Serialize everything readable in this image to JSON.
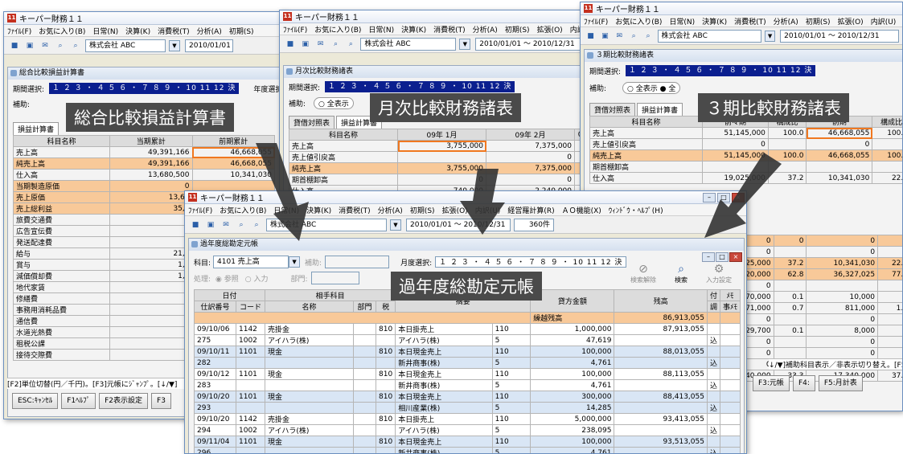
{
  "app_title": "キーパー財務１１",
  "app_icon_text": "11",
  "menu": [
    "ﾌｧｲﾙ(F)",
    "お気に入り(B)",
    "日常(N)",
    "決算(K)",
    "消費税(T)",
    "分析(A)",
    "初期(S)",
    "拡張(O)",
    "内訳(U)",
    "経営"
  ],
  "menu_front": [
    "ﾌｧｲﾙ(F)",
    "お気に入り(B)",
    "日常(N)",
    "決算(K)",
    "消費税(T)",
    "分析(A)",
    "初期(S)",
    "拡張(O)",
    "内訳(U)",
    "経営羅計算(R)",
    "ＡＯ機能(X)",
    "ｳｨﾝﾄﾞｳ・ﾍﾙﾌﾟ(H)"
  ],
  "company": "株式会社 ABC",
  "date_range": "2010/01/01 〜 2010/12/31",
  "record_count": "360件",
  "period_bar": "１ ２ ３ ・ ４ ５ ６ ・ ７ ８ ９ ・ 10 11 12 決",
  "captions": {
    "comprehensive": "総合比較損益計算書",
    "monthly": "月次比較財務諸表",
    "three_period": "３期比較財務諸表",
    "general_ledger": "過年度総勘定元帳"
  },
  "comprehensive": {
    "title": "総合比較損益計算書",
    "period_label": "期間選択:",
    "year_label": "年度選択:",
    "aux_label": "補助:",
    "tab": "損益計算書",
    "headers": [
      "科目名称",
      "当期累計",
      "前期累計"
    ],
    "rows": [
      {
        "name": "売上高",
        "cur": "49,391,166",
        "prev": "46,668,055",
        "orange": false
      },
      {
        "name": "純売上高",
        "cur": "49,391,166",
        "prev": "46,668,055",
        "orange": true
      },
      {
        "name": "仕入高",
        "cur": "13,680,500",
        "prev": "10,341,030",
        "orange": false
      },
      {
        "name": "当期製造原価",
        "cur": "0",
        "prev": "",
        "orange": true
      },
      {
        "name": "売上原価",
        "cur": "13,68",
        "prev": "",
        "orange": true
      },
      {
        "name": "売上総利益",
        "cur": "35,7",
        "prev": "",
        "orange": true
      },
      {
        "name": "旅費交通費",
        "cur": "",
        "prev": "",
        "orange": false
      },
      {
        "name": "広告宣伝費",
        "cur": "7",
        "prev": "",
        "orange": false
      },
      {
        "name": "発送配達費",
        "cur": "",
        "prev": "",
        "orange": false
      },
      {
        "name": "給与",
        "cur": "21,4",
        "prev": "",
        "orange": false
      },
      {
        "name": "賞与",
        "cur": "1,8",
        "prev": "",
        "orange": false
      },
      {
        "name": "減価償却費",
        "cur": "1,8",
        "prev": "",
        "orange": false
      },
      {
        "name": "地代家賃",
        "cur": "7",
        "prev": "",
        "orange": false
      },
      {
        "name": "修繕費",
        "cur": "3",
        "prev": "",
        "orange": false
      },
      {
        "name": "事務用消耗品費",
        "cur": "",
        "prev": "",
        "orange": false
      },
      {
        "name": "通信費",
        "cur": "3",
        "prev": "",
        "orange": false
      },
      {
        "name": "水道光熱費",
        "cur": "3",
        "prev": "",
        "orange": false
      },
      {
        "name": "租税公課",
        "cur": "",
        "prev": "",
        "orange": false
      },
      {
        "name": "接待交際費",
        "cur": "",
        "prev": "",
        "orange": false
      }
    ],
    "status": "[F2]単位切替(円／千円)。[F3]元帳にｼﾞｬﾝﾌﾟ。[↓/▼]",
    "fkeys": [
      "ESC:ｷｬﾝｾﾙ",
      "F1ﾍﾙﾌﾟ",
      "F2表示設定",
      "F3"
    ]
  },
  "monthly": {
    "title": "月次比較財務諸表",
    "period_label": "期間選択:",
    "aux_label": "補助:",
    "aux_option": "全表示",
    "tabs": [
      "貸借対照表",
      "損益計算書"
    ],
    "term_label": "期間",
    "headers": [
      "科目名称",
      "09年 1月",
      "09年 2月",
      "09"
    ],
    "rows": [
      {
        "name": "売上高",
        "m1": "3,755,000",
        "m2": "7,375,000",
        "orange": false
      },
      {
        "name": "売上値引戻高",
        "m1": "",
        "m2": "0",
        "orange": false
      },
      {
        "name": "純売上高",
        "m1": "3,755,000",
        "m2": "7,375,000",
        "orange": true
      },
      {
        "name": "期首棚卸高",
        "m1": "0",
        "m2": "0",
        "orange": false
      },
      {
        "name": "仕入高",
        "m1": "740,000",
        "m2": "2,240,000",
        "orange": false
      }
    ]
  },
  "three_period": {
    "title": "３期比較財務諸表",
    "period_label": "期間選択:",
    "aux_label": "補助:",
    "aux_options": [
      "全表示",
      "全"
    ],
    "tabs": [
      "貸借対照表",
      "損益計算書"
    ],
    "headers": [
      "科目名称",
      "前々期",
      "構成比",
      "前期",
      "構成比"
    ],
    "rows": [
      {
        "name": "売上高",
        "a": "51,145,000",
        "ar": "100.0",
        "b": "46,668,055",
        "br": "100.0",
        "orange": false
      },
      {
        "name": "売上値引戻高",
        "a": "0",
        "ar": "",
        "b": "0",
        "br": "",
        "orange": false
      },
      {
        "name": "純売上高",
        "a": "51,145,000",
        "ar": "100.0",
        "b": "46,668,055",
        "br": "100.0",
        "orange": true
      },
      {
        "name": "期首棚卸高",
        "a": "",
        "ar": "",
        "b": "",
        "br": "",
        "orange": false
      },
      {
        "name": "仕入高",
        "a": "19,025,000",
        "ar": "37.2",
        "b": "10,341,030",
        "br": "22.2",
        "orange": false
      }
    ],
    "lower_rows": [
      {
        "a": "0",
        "b": "0",
        "c": "0",
        "orange": true
      },
      {
        "a": "0",
        "b": "",
        "c": "0",
        "orange": false
      },
      {
        "a": "19,025,000",
        "b": "37.2",
        "c": "10,341,030",
        "d": "22.2",
        "orange": true
      },
      {
        "a": "32,120,000",
        "b": "62.8",
        "c": "36,327,025",
        "d": "77.8",
        "orange": true
      },
      {
        "a": "0",
        "b": "",
        "c": "",
        "orange": false
      },
      {
        "a": "70,000",
        "b": "0.1",
        "c": "10,000",
        "orange": false
      },
      {
        "a": "371,000",
        "b": "0.7",
        "c": "811,000",
        "d": "1.7",
        "orange": false
      },
      {
        "a": "0",
        "b": "",
        "c": "0",
        "orange": false
      },
      {
        "a": "29,700",
        "b": "0.1",
        "c": "8,000",
        "orange": false
      },
      {
        "a": "0",
        "b": "",
        "c": "0",
        "orange": false
      },
      {
        "a": "0",
        "b": "",
        "c": "0",
        "orange": false
      },
      {
        "a": "0",
        "b": "",
        "c": "0",
        "orange": false
      },
      {
        "a": "17,040,000",
        "b": "33.3",
        "c": "17,340,000",
        "d": "37.2",
        "orange": false
      }
    ],
    "status": "↓/▼]補助科目表示／非表示切り替え。[F5]科目",
    "fkeys": [
      "F3:元帳",
      "F4:",
      "F5:月計表"
    ]
  },
  "ledger": {
    "title": "過年度総勘定元帳",
    "account_label": "科目:",
    "account_value": "4101 売上高",
    "aux_label": "補助:",
    "month_label": "月度選択:",
    "process_label": "処理:",
    "process_options": [
      "参照",
      "入力"
    ],
    "dept_label": "部門:",
    "tools": [
      "検索解除",
      "検索",
      "入力設定"
    ],
    "headers_top": [
      "日付",
      "相手科目",
      "摘要",
      "貸方金額",
      "残高",
      "付",
      "ﾒﾓ"
    ],
    "headers_bottom": [
      "仕訳番号",
      "コード",
      "名称",
      "部門",
      "税",
      "取引先",
      "調",
      "事ﾒﾓ"
    ],
    "carry_label": "繰越残高",
    "carry_balance": "86,913,055",
    "rows": [
      {
        "date": "09/10/06",
        "code": "1142",
        "name": "売掛金",
        "dept": "810",
        "desc": "本日掛売上",
        "tax": "110",
        "flag": "",
        "amount": "1,000,000",
        "balance": "87,913,055",
        "alt": false
      },
      {
        "date": "275",
        "code": "1002",
        "name": "アイハラ(株)",
        "dept": "",
        "desc": "アイハラ(株)",
        "tax": "5",
        "flag": "込",
        "amount": "47,619",
        "balance": "",
        "alt": false
      },
      {
        "date": "09/10/11",
        "code": "1101",
        "name": "現金",
        "dept": "810",
        "desc": "本日現金売上",
        "tax": "110",
        "flag": "",
        "amount": "100,000",
        "balance": "88,013,055",
        "alt": true
      },
      {
        "date": "282",
        "code": "",
        "name": "",
        "dept": "",
        "desc": "新井商事(株)",
        "tax": "5",
        "flag": "込",
        "amount": "4,761",
        "balance": "",
        "alt": true
      },
      {
        "date": "09/10/12",
        "code": "1101",
        "name": "現金",
        "dept": "810",
        "desc": "本日現金売上",
        "tax": "110",
        "flag": "",
        "amount": "100,000",
        "balance": "88,113,055",
        "alt": false
      },
      {
        "date": "283",
        "code": "",
        "name": "",
        "dept": "",
        "desc": "新井商事(株)",
        "tax": "5",
        "flag": "込",
        "amount": "4,761",
        "balance": "",
        "alt": false
      },
      {
        "date": "09/10/20",
        "code": "1101",
        "name": "現金",
        "dept": "810",
        "desc": "本日現金売上",
        "tax": "110",
        "flag": "",
        "amount": "300,000",
        "balance": "88,413,055",
        "alt": true
      },
      {
        "date": "293",
        "code": "",
        "name": "",
        "dept": "",
        "desc": "相川産業(株)",
        "tax": "5",
        "flag": "込",
        "amount": "14,285",
        "balance": "",
        "alt": true
      },
      {
        "date": "09/10/20",
        "code": "1142",
        "name": "売掛金",
        "dept": "810",
        "desc": "本日掛売上",
        "tax": "110",
        "flag": "",
        "amount": "5,000,000",
        "balance": "93,413,055",
        "alt": false
      },
      {
        "date": "294",
        "code": "1002",
        "name": "アイハラ(株)",
        "dept": "",
        "desc": "アイハラ(株)",
        "tax": "5",
        "flag": "込",
        "amount": "238,095",
        "balance": "",
        "alt": false
      },
      {
        "date": "09/11/04",
        "code": "1101",
        "name": "現金",
        "dept": "810",
        "desc": "本日現金売上",
        "tax": "110",
        "flag": "",
        "amount": "100,000",
        "balance": "93,513,055",
        "alt": true
      },
      {
        "date": "296",
        "code": "",
        "name": "",
        "dept": "",
        "desc": "新井商事(株)",
        "tax": "5",
        "flag": "込",
        "amount": "4,761",
        "balance": "",
        "alt": true
      }
    ]
  },
  "colors": {
    "accent_orange": "#f07820",
    "row_orange": "#f8c999",
    "period_blue": "#0b1f8f",
    "caption_bg": "#4a4a4a"
  }
}
